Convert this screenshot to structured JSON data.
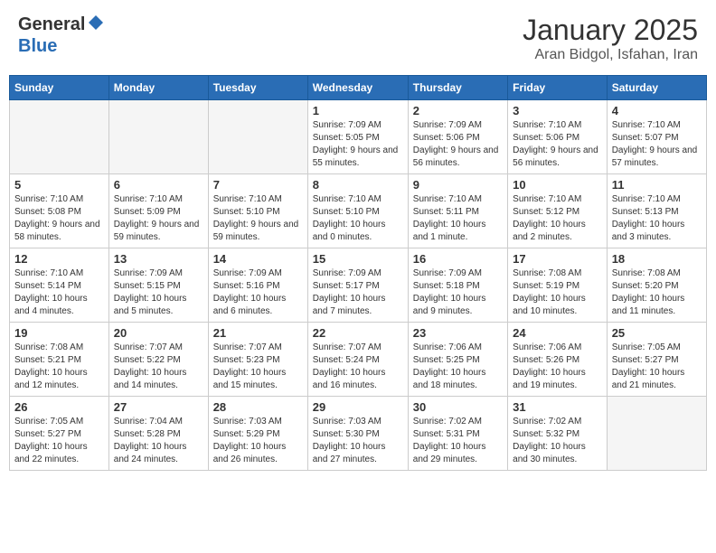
{
  "header": {
    "logo_general": "General",
    "logo_blue": "Blue",
    "month": "January 2025",
    "location": "Aran Bidgol, Isfahan, Iran"
  },
  "weekdays": [
    "Sunday",
    "Monday",
    "Tuesday",
    "Wednesday",
    "Thursday",
    "Friday",
    "Saturday"
  ],
  "weeks": [
    [
      {
        "day": "",
        "info": ""
      },
      {
        "day": "",
        "info": ""
      },
      {
        "day": "",
        "info": ""
      },
      {
        "day": "1",
        "info": "Sunrise: 7:09 AM\nSunset: 5:05 PM\nDaylight: 9 hours and 55 minutes."
      },
      {
        "day": "2",
        "info": "Sunrise: 7:09 AM\nSunset: 5:06 PM\nDaylight: 9 hours and 56 minutes."
      },
      {
        "day": "3",
        "info": "Sunrise: 7:10 AM\nSunset: 5:06 PM\nDaylight: 9 hours and 56 minutes."
      },
      {
        "day": "4",
        "info": "Sunrise: 7:10 AM\nSunset: 5:07 PM\nDaylight: 9 hours and 57 minutes."
      }
    ],
    [
      {
        "day": "5",
        "info": "Sunrise: 7:10 AM\nSunset: 5:08 PM\nDaylight: 9 hours and 58 minutes."
      },
      {
        "day": "6",
        "info": "Sunrise: 7:10 AM\nSunset: 5:09 PM\nDaylight: 9 hours and 59 minutes."
      },
      {
        "day": "7",
        "info": "Sunrise: 7:10 AM\nSunset: 5:10 PM\nDaylight: 9 hours and 59 minutes."
      },
      {
        "day": "8",
        "info": "Sunrise: 7:10 AM\nSunset: 5:10 PM\nDaylight: 10 hours and 0 minutes."
      },
      {
        "day": "9",
        "info": "Sunrise: 7:10 AM\nSunset: 5:11 PM\nDaylight: 10 hours and 1 minute."
      },
      {
        "day": "10",
        "info": "Sunrise: 7:10 AM\nSunset: 5:12 PM\nDaylight: 10 hours and 2 minutes."
      },
      {
        "day": "11",
        "info": "Sunrise: 7:10 AM\nSunset: 5:13 PM\nDaylight: 10 hours and 3 minutes."
      }
    ],
    [
      {
        "day": "12",
        "info": "Sunrise: 7:10 AM\nSunset: 5:14 PM\nDaylight: 10 hours and 4 minutes."
      },
      {
        "day": "13",
        "info": "Sunrise: 7:09 AM\nSunset: 5:15 PM\nDaylight: 10 hours and 5 minutes."
      },
      {
        "day": "14",
        "info": "Sunrise: 7:09 AM\nSunset: 5:16 PM\nDaylight: 10 hours and 6 minutes."
      },
      {
        "day": "15",
        "info": "Sunrise: 7:09 AM\nSunset: 5:17 PM\nDaylight: 10 hours and 7 minutes."
      },
      {
        "day": "16",
        "info": "Sunrise: 7:09 AM\nSunset: 5:18 PM\nDaylight: 10 hours and 9 minutes."
      },
      {
        "day": "17",
        "info": "Sunrise: 7:08 AM\nSunset: 5:19 PM\nDaylight: 10 hours and 10 minutes."
      },
      {
        "day": "18",
        "info": "Sunrise: 7:08 AM\nSunset: 5:20 PM\nDaylight: 10 hours and 11 minutes."
      }
    ],
    [
      {
        "day": "19",
        "info": "Sunrise: 7:08 AM\nSunset: 5:21 PM\nDaylight: 10 hours and 12 minutes."
      },
      {
        "day": "20",
        "info": "Sunrise: 7:07 AM\nSunset: 5:22 PM\nDaylight: 10 hours and 14 minutes."
      },
      {
        "day": "21",
        "info": "Sunrise: 7:07 AM\nSunset: 5:23 PM\nDaylight: 10 hours and 15 minutes."
      },
      {
        "day": "22",
        "info": "Sunrise: 7:07 AM\nSunset: 5:24 PM\nDaylight: 10 hours and 16 minutes."
      },
      {
        "day": "23",
        "info": "Sunrise: 7:06 AM\nSunset: 5:25 PM\nDaylight: 10 hours and 18 minutes."
      },
      {
        "day": "24",
        "info": "Sunrise: 7:06 AM\nSunset: 5:26 PM\nDaylight: 10 hours and 19 minutes."
      },
      {
        "day": "25",
        "info": "Sunrise: 7:05 AM\nSunset: 5:27 PM\nDaylight: 10 hours and 21 minutes."
      }
    ],
    [
      {
        "day": "26",
        "info": "Sunrise: 7:05 AM\nSunset: 5:27 PM\nDaylight: 10 hours and 22 minutes."
      },
      {
        "day": "27",
        "info": "Sunrise: 7:04 AM\nSunset: 5:28 PM\nDaylight: 10 hours and 24 minutes."
      },
      {
        "day": "28",
        "info": "Sunrise: 7:03 AM\nSunset: 5:29 PM\nDaylight: 10 hours and 26 minutes."
      },
      {
        "day": "29",
        "info": "Sunrise: 7:03 AM\nSunset: 5:30 PM\nDaylight: 10 hours and 27 minutes."
      },
      {
        "day": "30",
        "info": "Sunrise: 7:02 AM\nSunset: 5:31 PM\nDaylight: 10 hours and 29 minutes."
      },
      {
        "day": "31",
        "info": "Sunrise: 7:02 AM\nSunset: 5:32 PM\nDaylight: 10 hours and 30 minutes."
      },
      {
        "day": "",
        "info": ""
      }
    ]
  ]
}
